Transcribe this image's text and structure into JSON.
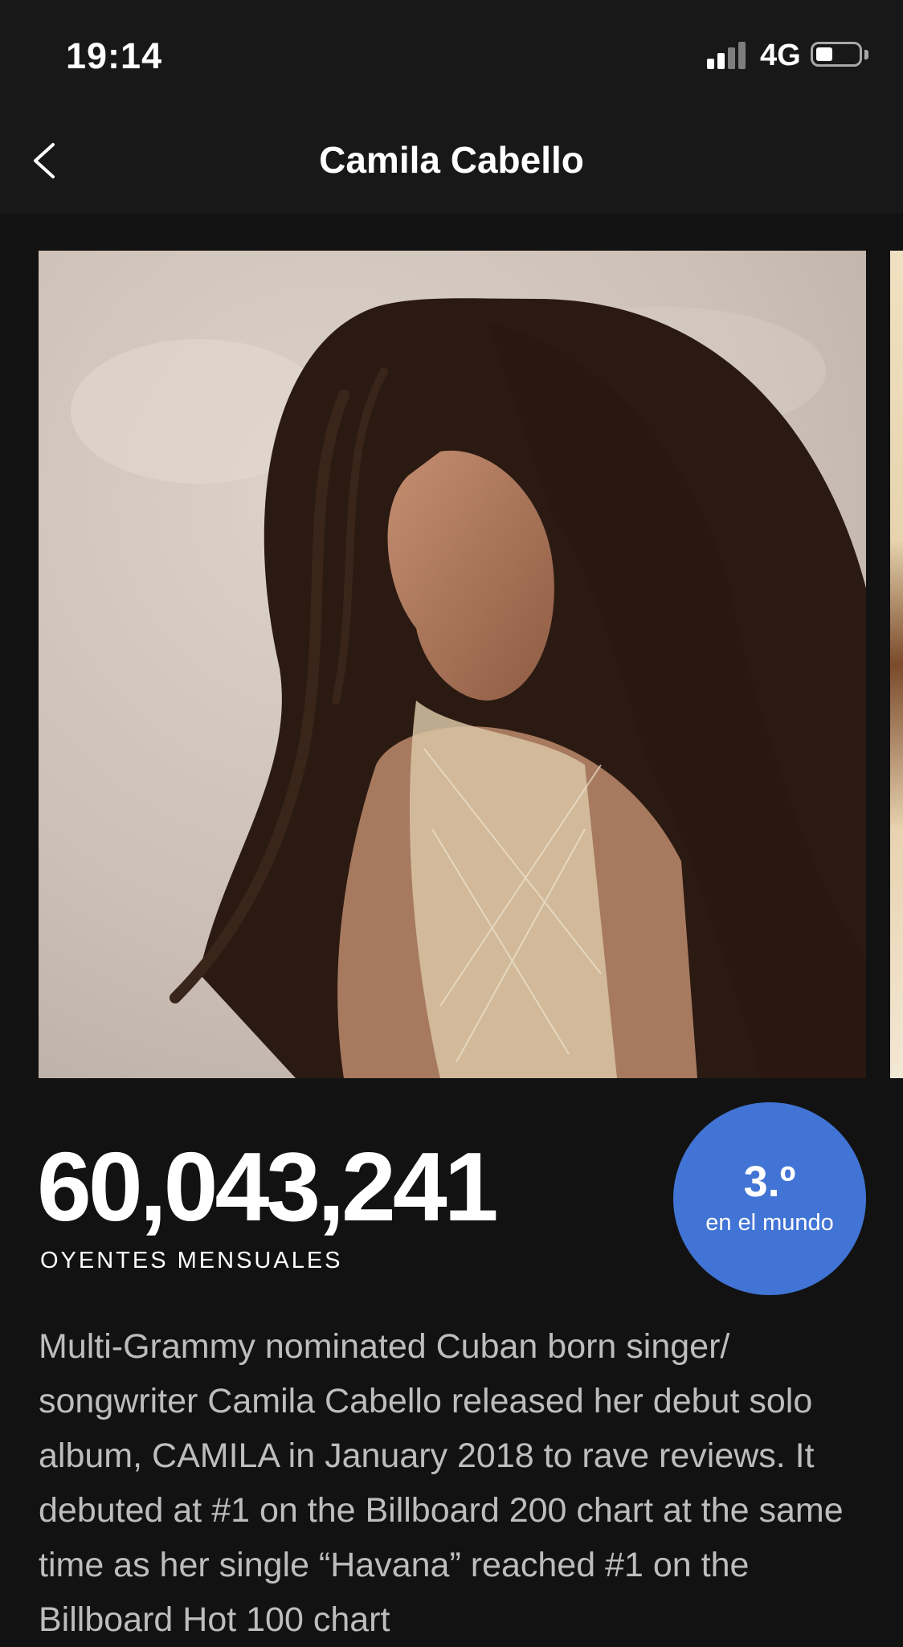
{
  "status_bar": {
    "time": "19:14",
    "network": "4G"
  },
  "header": {
    "title": "Camila Cabello",
    "back_icon": "chevron-left-icon"
  },
  "stats": {
    "monthly_listeners": "60,043,241",
    "monthly_listeners_label": "OYENTES MENSUALES",
    "rank_position": "3.º",
    "rank_scope": "en el mundo"
  },
  "biography": "Multi-Grammy nominated Cuban born singer/ songwriter Camila Cabello released her debut solo album, CAMILA in January 2018 to rave reviews. It debuted at #1 on the Billboard 200 chart at the same time as her single “Havana” reached #1 on the Billboard Hot 100 chart",
  "colors": {
    "background": "#121212",
    "bar": "#181818",
    "rank_badge": "#4174d4",
    "bio_text": "#bdbdbd"
  }
}
